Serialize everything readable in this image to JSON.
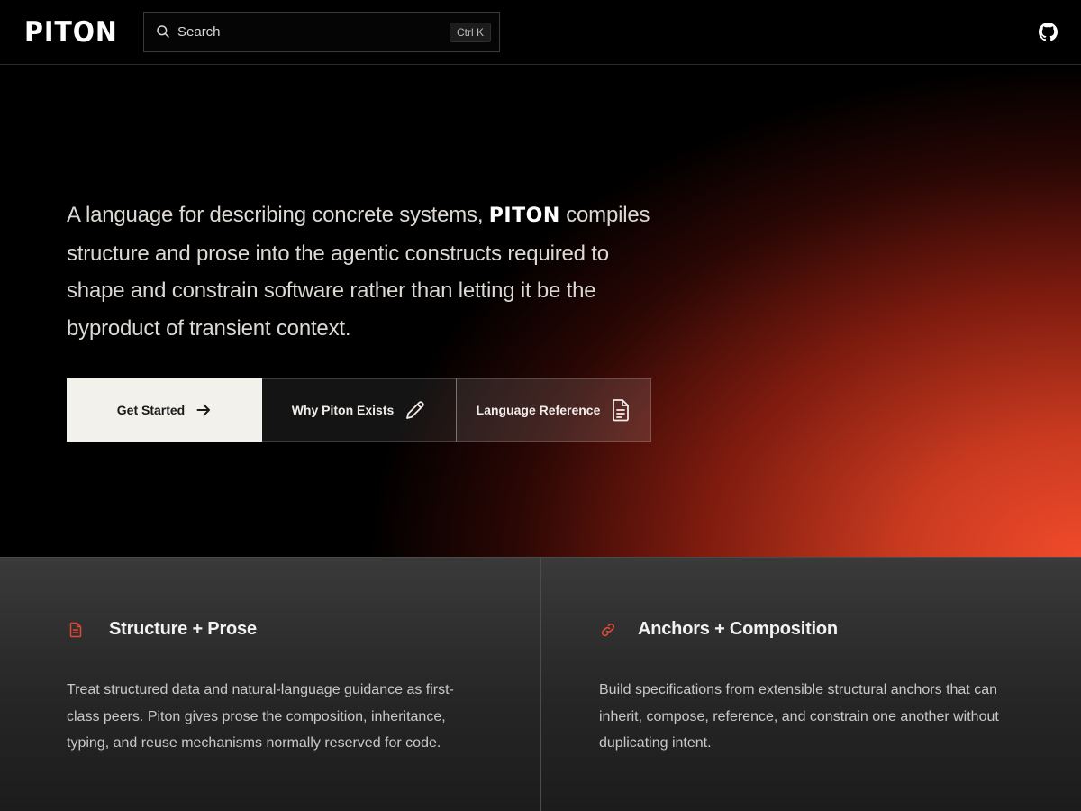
{
  "header": {
    "logo": "PITON",
    "search": {
      "label": "Search",
      "shortcut": "Ctrl K"
    },
    "github_icon": "github-icon"
  },
  "hero": {
    "text_before": "A language for describing concrete systems, ",
    "brand": "PITON",
    "text_after": " compiles structure and prose into the agentic constructs required to shape and constrain software rather than letting it be the byproduct of transient context.",
    "buttons": [
      {
        "label": "Get Started",
        "icon": "arrow-right-icon"
      },
      {
        "label": "Why Piton Exists",
        "icon": "pencil-icon"
      },
      {
        "label": "Language Reference",
        "icon": "document-icon"
      }
    ]
  },
  "features": [
    {
      "title": "Structure + Prose",
      "icon": "document-icon",
      "description": "Treat structured data and natural-language guidance as first-class peers. Piton gives prose the composition, inheritance, typing, and reuse mechanisms normally reserved for code."
    },
    {
      "title": "Anchors + Composition",
      "icon": "link-icon",
      "description": "Build specifications from extensible structural anchors that can inherit, compose, reference, and constrain one another without duplicating intent."
    }
  ],
  "colors": {
    "accent": "#f04a2a",
    "icon_accent": "#e0483a"
  }
}
